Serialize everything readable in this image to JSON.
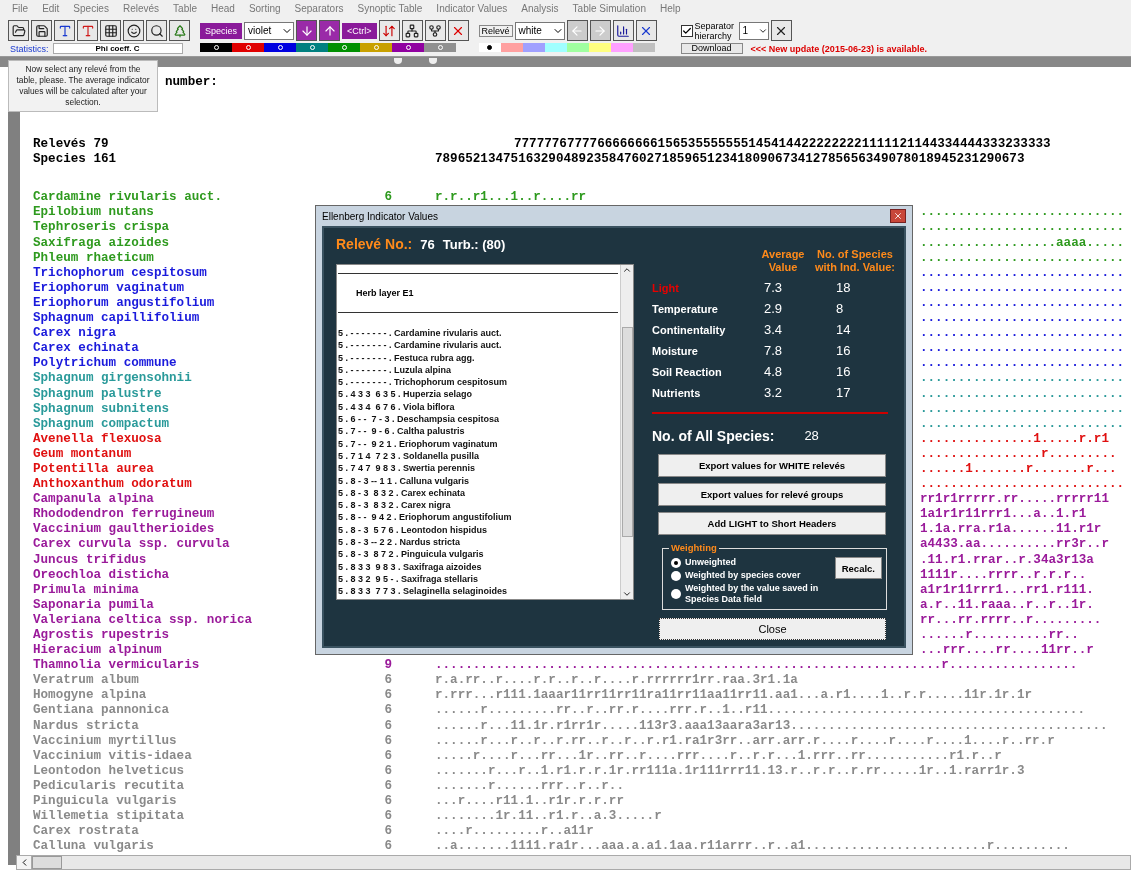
{
  "menu": [
    "File",
    "Edit",
    "Species",
    "Relevés",
    "Table",
    "Head",
    "Sorting",
    "Separators",
    "Synoptic Table",
    "Indicator Values",
    "Analysis",
    "Table Simulation",
    "Help"
  ],
  "toolbar": {
    "statistics_label": "Statistics:",
    "statistics_value": "Phi coeff. C",
    "species_label": "Species",
    "species_color": "violet",
    "ctrl_label": "<Ctrl>",
    "species_palette": [
      {
        "color": "#000000"
      },
      {
        "color": "#e00000"
      },
      {
        "color": "#0000e0"
      },
      {
        "color": "#008080"
      },
      {
        "color": "#009000"
      },
      {
        "color": "#c8a000"
      },
      {
        "color": "#9000a0"
      },
      {
        "color": "#909090"
      }
    ],
    "releve_label": "Relevé",
    "releve_color": "white",
    "releve_palette": [
      {
        "color": "#ffffff",
        "selected": true
      },
      {
        "color": "#ffa0a0",
        "selected": false
      },
      {
        "color": "#a0a0ff",
        "selected": false
      },
      {
        "color": "#a0ffff",
        "selected": false
      },
      {
        "color": "#a0ffa0",
        "selected": false
      },
      {
        "color": "#ffff80",
        "selected": false
      },
      {
        "color": "#ffa0ff",
        "selected": false
      },
      {
        "color": "#c0c0c0",
        "selected": false
      }
    ],
    "separator": {
      "label": "Separator hierarchy",
      "checked": true,
      "value": "1"
    },
    "download": "Download",
    "update_notice": "<<< New update (2015-06-23) is available."
  },
  "tooltip": "Now select any relevé from the table, please. The average indicator values will be calculated after your selection.",
  "table": {
    "header_label": "number:",
    "releves_label": "Relevés 79",
    "species_label": "Species 161",
    "releve_digits": "77777767777666666661565355555551454144222222221111121144334444333233333",
    "species_digits": "789652134751632904892358476027185965123418090673412785656349078018945231290673",
    "rows": [
      {
        "name": "Cardamine rivularis auct.",
        "color": "#2e9a1e",
        "count": "6",
        "data": "r.r..r1...1..r....rr",
        "covered": false
      },
      {
        "name": "Epilobium nutans",
        "color": "#2e9a1e",
        "data": "...........................",
        "covered": true
      },
      {
        "name": "Tephroseris crispa",
        "color": "#2e9a1e",
        "data": "...........................",
        "covered": true
      },
      {
        "name": "Saxifraga aizoides",
        "color": "#2e9a1e",
        "data": "..................aaaa.....",
        "covered": true
      },
      {
        "name": "Phleum rhaeticum",
        "color": "#2e9a1e",
        "data": "...........................",
        "covered": true
      },
      {
        "name": "Trichophorum cespitosum",
        "color": "#1a1adc",
        "data": "...........................",
        "covered": true
      },
      {
        "name": "Eriophorum vaginatum",
        "color": "#1a1adc",
        "data": "...........................",
        "covered": true
      },
      {
        "name": "Eriophorum angustifolium",
        "color": "#1a1adc",
        "data": "...........................",
        "covered": true
      },
      {
        "name": "Sphagnum capillifolium",
        "color": "#1a1adc",
        "data": "...........................",
        "covered": true
      },
      {
        "name": "Carex nigra",
        "color": "#1a1adc",
        "data": "...........................",
        "covered": true
      },
      {
        "name": "Carex echinata",
        "color": "#1a1adc",
        "data": "...........................",
        "covered": true
      },
      {
        "name": "Polytrichum commune",
        "color": "#1a1adc",
        "data": "...........................",
        "covered": true
      },
      {
        "name": "Sphagnum girgensohnii",
        "color": "#2a9a9a",
        "data": "...........................",
        "covered": true
      },
      {
        "name": "Sphagnum palustre",
        "color": "#2a9a9a",
        "data": "...........................",
        "covered": true
      },
      {
        "name": "Sphagnum subnitens",
        "color": "#2a9a9a",
        "data": "...........................",
        "covered": true
      },
      {
        "name": "Sphagnum compactum",
        "color": "#2a9a9a",
        "data": "...........................",
        "covered": true
      },
      {
        "name": "Avenella flexuosa",
        "color": "#e01010",
        "data": "...............1.....r.r1",
        "covered": true
      },
      {
        "name": "Geum montanum",
        "color": "#e01010",
        "data": "................r.........",
        "covered": true
      },
      {
        "name": "Potentilla aurea",
        "color": "#e01010",
        "data": "......1.......r.......r...",
        "covered": true
      },
      {
        "name": "Anthoxanthum odoratum",
        "color": "#e01010",
        "data": "...........................",
        "covered": true
      },
      {
        "name": "Campanula alpina",
        "color": "#9a1a9a",
        "data": "rr1r1rrrrr.rr.....rrrrr11",
        "covered": true
      },
      {
        "name": "Rhododendron ferrugineum",
        "color": "#9a1a9a",
        "data": "1a1r1r11rrr1...a..1.r1",
        "covered": true
      },
      {
        "name": "Vaccinium gaultherioides",
        "color": "#9a1a9a",
        "data": "1.1a.rra.r1a......11.r1r",
        "covered": true
      },
      {
        "name": "Carex curvula ssp. curvula",
        "color": "#9a1a9a",
        "data": "a4433.aa..........rr3r..r",
        "covered": true
      },
      {
        "name": "Juncus trifidus",
        "color": "#9a1a9a",
        "data": ".11.r1.rrar..r.34a3r13a",
        "covered": true
      },
      {
        "name": "Oreochloa disticha",
        "color": "#9a1a9a",
        "data": "1111r....rrrr..r.r.r..",
        "covered": true
      },
      {
        "name": "Primula minima",
        "color": "#9a1a9a",
        "data": "a1r1r11rrr1...rr1.r111.",
        "covered": true
      },
      {
        "name": "Saponaria pumila",
        "color": "#9a1a9a",
        "data": "a.r..11.raaa..r..r..1r.",
        "covered": true
      },
      {
        "name": "Valeriana celtica ssp. norica",
        "color": "#9a1a9a",
        "data": "rr...rr.rrrr..r.........",
        "covered": true
      },
      {
        "name": "Agrostis rupestris",
        "color": "#9a1a9a",
        "data": "......r..........rr..",
        "covered": true
      },
      {
        "name": "Hieracium alpinum",
        "color": "#9a1a9a",
        "data": "...rrr....rr....11rr..r",
        "covered": true
      },
      {
        "name": "Thamnolia vermicularis",
        "color": "#9a1a9a",
        "count": "9",
        "data": "...................................................................r.................",
        "covered": false
      },
      {
        "name": "Veratrum album",
        "color": "#8a8a8a",
        "count": "6",
        "data": "r.a.rr..r....r.r..r..r....r.rrrrrr1rr.raa.3r1.1a",
        "covered": false
      },
      {
        "name": "Homogyne alpina",
        "color": "#8a8a8a",
        "count": "6",
        "data": "r.rrr...r111.1aaar11rr11rr11ra11rr11aa11rr11.aa1...a.r1....1..r.r.....11r.1r.1r",
        "covered": false
      },
      {
        "name": "Gentiana pannonica",
        "color": "#8a8a8a",
        "count": "6",
        "data": "......r.........rr..r..rr.r....rrr.r..1..r11..........................................",
        "covered": false
      },
      {
        "name": "Nardus stricta",
        "color": "#8a8a8a",
        "count": "6",
        "data": "......r...11.1r.r1rr1r.....113r3.aaa13aara3ar13..........................................",
        "covered": false
      },
      {
        "name": "Vaccinium myrtillus",
        "color": "#8a8a8a",
        "count": "6",
        "data": "......r...r..r..r.rr..r..r..r.r1.ra1r3rr..arr.arr.r....r....r....r....1....r..rr.r",
        "covered": false
      },
      {
        "name": "Vaccinium vitis-idaea",
        "color": "#8a8a8a",
        "count": "6",
        "data": ".....r....r...rr...1r..rr..r....rrr....r..r.r...1.rrr..rr...........r1.r..r",
        "covered": false
      },
      {
        "name": "Leontodon helveticus",
        "color": "#8a8a8a",
        "count": "6",
        "data": ".......r...r..1.r1.r.r.1r.rr111a.1r111rrr11.13.r..r.r..r.rr.....1r..1.rarr1r.3",
        "covered": false
      },
      {
        "name": "Pedicularis recutita",
        "color": "#8a8a8a",
        "count": "6",
        "data": ".......r......rrr..r..r..",
        "covered": false
      },
      {
        "name": "Pinguicula vulgaris",
        "color": "#8a8a8a",
        "count": "6",
        "data": "...r....r11.1..r1r.r.r.rr",
        "covered": false
      },
      {
        "name": "Willemetia stipitata",
        "color": "#8a8a8a",
        "count": "6",
        "data": "........1r.11..r1.r..a.3.....r",
        "covered": false
      },
      {
        "name": "Carex rostrata",
        "color": "#8a8a8a",
        "count": "6",
        "data": "....r.........r..a11r",
        "covered": false
      },
      {
        "name": "Calluna vulgaris",
        "color": "#8a8a8a",
        "count": "6",
        "data": "..a.......1111.ra1r...aaa.a.a1.1aa.r11arrr..r..a1........................r..........",
        "covered": false
      }
    ]
  },
  "dialog": {
    "title": "Ellenberg Indicator Values",
    "releve_label": "Relevé No.:",
    "releve_value": "76",
    "turb": "Turb.: (80)",
    "list_header": "Herb layer E1",
    "list": [
      "5 . - - - - - - - . Cardamine rivularis auct.",
      "5 . - - - - - - - . Cardamine rivularis auct.",
      "5 . - - - - - - - . Festuca rubra agg.",
      "5 . - - - - - - - . Luzula alpina",
      "5 . - - - - - - - . Trichophorum cespitosum",
      "5 . 4 3 3  6 3 5 . Huperzia selago",
      "5 . 4 3 4  6 7 6 . Viola biflora",
      "5 . 6 - -  7 - 3 . Deschampsia cespitosa",
      "5 . 7 - -  9 - 6 . Caltha palustris",
      "5 . 7 - -  9 2 1 . Eriophorum vaginatum",
      "5 . 7 1 4  7 2 3 . Soldanella pusilla",
      "5 . 7 4 7  9 8 3 . Swertia perennis",
      "5 . 8 - 3 -- 1 1 . Calluna vulgaris",
      "5 . 8 - 3  8 3 2 . Carex echinata",
      "5 . 8 - 3  8 3 2 . Carex nigra",
      "5 . 8 - -  9 4 2 . Eriophorum angustifolium",
      "5 . 8 - 3  5 7 6 . Leontodon hispidus",
      "5 . 8 - 3 -- 2 2 . Nardus stricta",
      "5 . 8 - 3  8 7 2 . Pinguicula vulgaris",
      "5 . 8 3 3  9 8 3 . Saxifraga aizoides",
      "5 . 8 3 2  9 5 - . Saxifraga stellaris",
      "5 . 8 3 3  7 7 3 . Selaginella selaginoides"
    ],
    "columns": [
      "Average Value",
      "No. of Species with Ind. Value:"
    ],
    "indicators": [
      {
        "name": "Light",
        "average": "7.3",
        "count": "18",
        "selected": true
      },
      {
        "name": "Temperature",
        "average": "2.9",
        "count": "8",
        "selected": false
      },
      {
        "name": "Continentality",
        "average": "3.4",
        "count": "14",
        "selected": false
      },
      {
        "name": "Moisture",
        "average": "7.8",
        "count": "16",
        "selected": false
      },
      {
        "name": "Soil Reaction",
        "average": "4.8",
        "count": "16",
        "selected": false
      },
      {
        "name": "Nutrients",
        "average": "3.2",
        "count": "17",
        "selected": false
      }
    ],
    "all_species_label": "No. of All Species:",
    "all_species_value": "28",
    "buttons": [
      "Export values for WHITE relevés",
      "Export values for relevé groups",
      "Add LIGHT to Short Headers"
    ],
    "weighting": {
      "title": "Weighting",
      "recalc": "Recalc.",
      "options": [
        {
          "label": "Unweighted",
          "selected": true
        },
        {
          "label": "Weighted by species cover",
          "selected": false
        },
        {
          "label": "Weighted by the value saved in Species Data field",
          "selected": false
        }
      ]
    },
    "close": "Close"
  }
}
